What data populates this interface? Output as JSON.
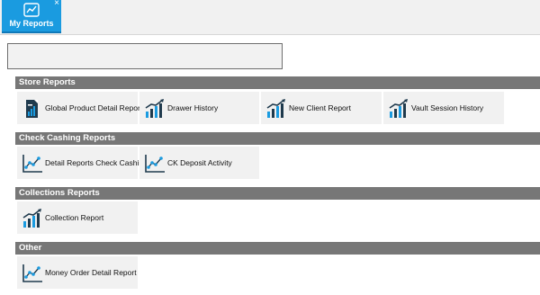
{
  "tab": {
    "label": "My Reports",
    "close": "×",
    "color": "#1a9be0"
  },
  "search": {
    "value": "",
    "placeholder": ""
  },
  "sections": [
    {
      "title": "Store Reports",
      "reports": [
        {
          "label": "Global Product Detail Report",
          "icon": "document-chart-icon"
        },
        {
          "label": "Drawer History",
          "icon": "bar-chart-trend-icon"
        },
        {
          "label": "New Client Report",
          "icon": "bar-chart-trend-icon"
        },
        {
          "label": "Vault Session History",
          "icon": "bar-chart-trend-icon"
        }
      ]
    },
    {
      "title": "Check Cashing Reports",
      "reports": [
        {
          "label": "Detail Reports Check Cashing",
          "icon": "line-chart-icon"
        },
        {
          "label": "CK Deposit Activity",
          "icon": "line-chart-icon"
        }
      ]
    },
    {
      "title": "Collections Reports",
      "reports": [
        {
          "label": "Collection Report",
          "icon": "bar-chart-trend-icon"
        }
      ]
    },
    {
      "title": "Other",
      "reports": [
        {
          "label": "Money Order Detail Report",
          "icon": "line-chart-icon"
        }
      ]
    }
  ],
  "colors": {
    "header": "#777777",
    "tile": "#f1f1f1",
    "icon_dark": "#1f3a4d",
    "icon_accent": "#1a9be0"
  }
}
